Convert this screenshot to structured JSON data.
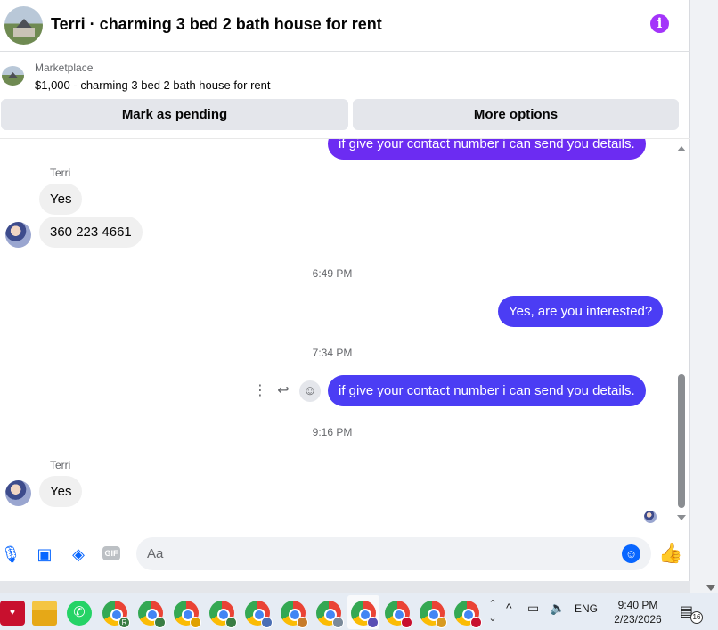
{
  "header": {
    "title": "Terri · charming 3 bed 2 bath house for rent",
    "info_icon": "info-icon"
  },
  "listing": {
    "source": "Marketplace",
    "title": "$1,000 - charming 3 bed 2 bath house for rent"
  },
  "actions": {
    "mark_pending": "Mark as pending",
    "more_options": "More options"
  },
  "messages": {
    "top_partial": "if give your contact number  i can send you details.",
    "sender_1": "Terri",
    "msg_yes_1": "Yes",
    "msg_phone": "360 223 4661",
    "time_1": "6:49 PM",
    "msg_interested": "Yes, are you interested?",
    "time_2": "7:34 PM",
    "msg_contact": "if give your contact number  i can send you details.",
    "time_3": "9:16 PM",
    "sender_2": "Terri",
    "msg_yes_2": "Yes"
  },
  "composer": {
    "placeholder": "Aa",
    "gif_label": "GIF"
  },
  "taskbar": {
    "language": "ENG",
    "time": "9:40 PM",
    "date": "2/23/2026",
    "notification_count": "16"
  },
  "colors": {
    "outgoing": "#6c2cf2",
    "incoming": "#f0f0f0",
    "accent": "#0866ff",
    "info": "#a334fa"
  }
}
